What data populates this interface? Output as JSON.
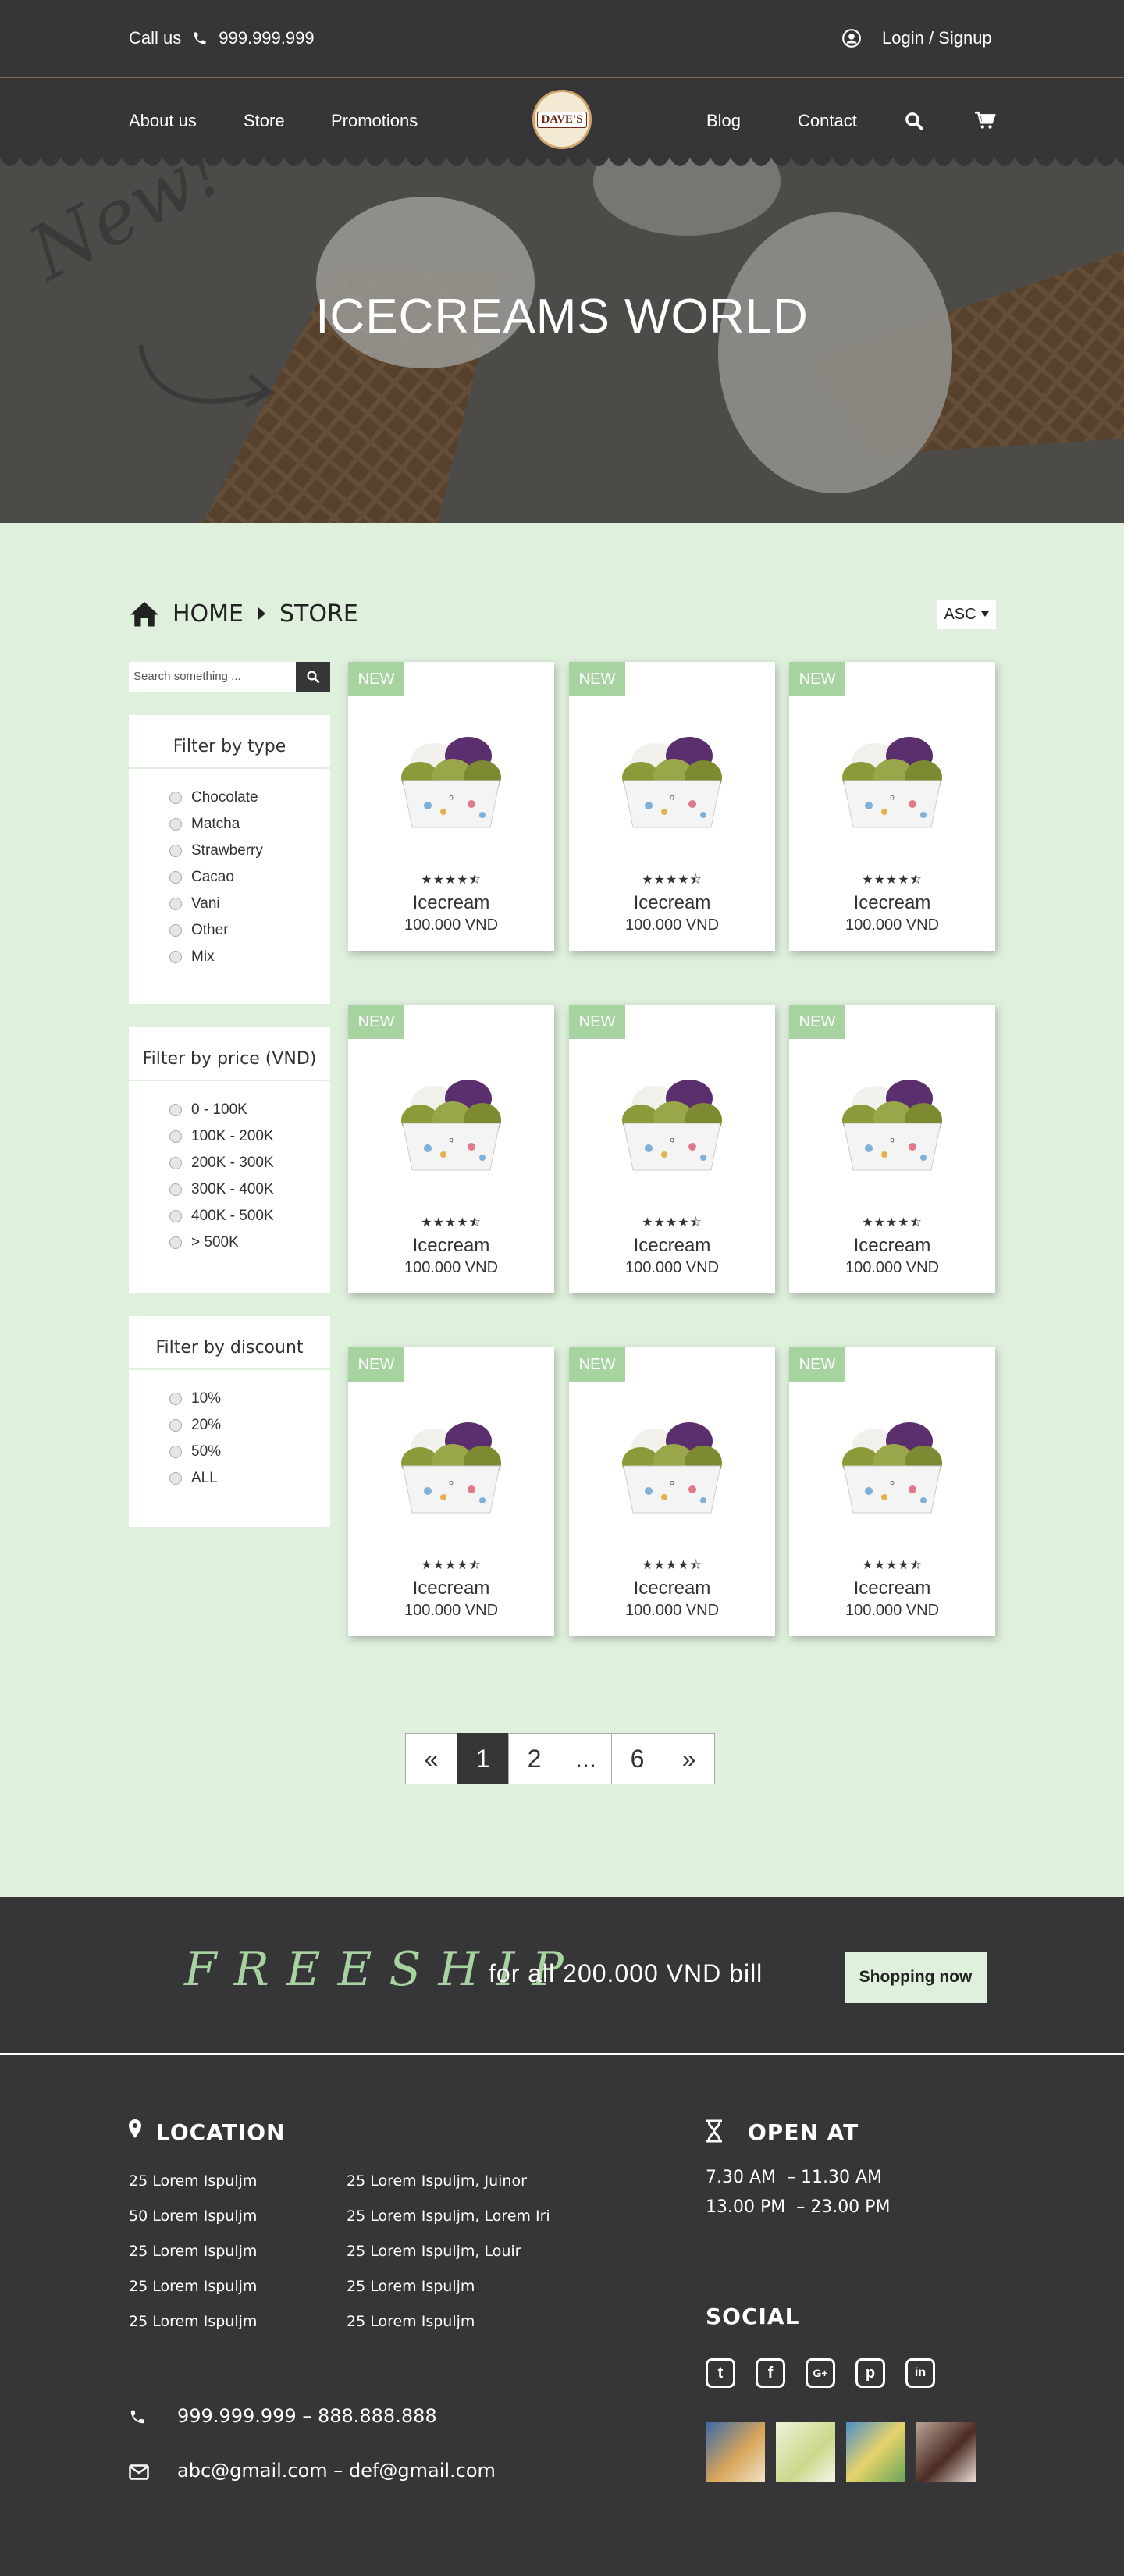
{
  "topbar": {
    "call_label": "Call us",
    "phone": "999.999.999",
    "login": "Login / Signup"
  },
  "nav": {
    "about": "About us",
    "store": "Store",
    "promotions": "Promotions",
    "blog": "Blog",
    "contact": "Contact",
    "logo_text": "DAVE'S"
  },
  "hero": {
    "title": "ICECREAMS WORLD",
    "badge": "New!"
  },
  "breadcrumb": {
    "home": "HOME",
    "store": "STORE"
  },
  "sort": {
    "value": "ASC"
  },
  "search": {
    "placeholder": "Search something ..."
  },
  "filters": [
    {
      "title": "Filter by type",
      "options": [
        "Chocolate",
        "Matcha",
        "Strawberry",
        "Cacao",
        "Vani",
        "Other",
        "Mix"
      ]
    },
    {
      "title": "Filter by price (VND)",
      "options": [
        "0 - 100K",
        "100K - 200K",
        "200K - 300K",
        "300K - 400K",
        "400K - 500K",
        "> 500K"
      ]
    },
    {
      "title": "Filter by discount",
      "options": [
        "10%",
        "20%",
        "50%",
        "ALL"
      ]
    }
  ],
  "products": [
    {
      "tag": "NEW",
      "name": "Icecream",
      "price": "100.000 VND",
      "rating": 4.5
    },
    {
      "tag": "NEW",
      "name": "Icecream",
      "price": "100.000 VND",
      "rating": 4.5
    },
    {
      "tag": "NEW",
      "name": "Icecream",
      "price": "100.000 VND",
      "rating": 4.5
    },
    {
      "tag": "NEW",
      "name": "Icecream",
      "price": "100.000 VND",
      "rating": 4.5
    },
    {
      "tag": "NEW",
      "name": "Icecream",
      "price": "100.000 VND",
      "rating": 4.5
    },
    {
      "tag": "NEW",
      "name": "Icecream",
      "price": "100.000 VND",
      "rating": 4.5
    },
    {
      "tag": "NEW",
      "name": "Icecream",
      "price": "100.000 VND",
      "rating": 4.5
    },
    {
      "tag": "NEW",
      "name": "Icecream",
      "price": "100.000 VND",
      "rating": 4.5
    },
    {
      "tag": "NEW",
      "name": "Icecream",
      "price": "100.000 VND",
      "rating": 4.5
    }
  ],
  "pagination": {
    "prev": "«",
    "pages": [
      "1",
      "2",
      "...",
      "6"
    ],
    "next": "»",
    "current": "1"
  },
  "promo": {
    "headline": "FREESHIP",
    "text": "for all 200.000 VND bill",
    "button": "Shopping now"
  },
  "footer": {
    "location_title": "LOCATION",
    "addresses_left": [
      "25 Lorem Ispuljm",
      "50 Lorem Ispuljm",
      "25 Lorem Ispuljm",
      "25 Lorem Ispuljm",
      "25 Lorem Ispuljm"
    ],
    "addresses_right": [
      "25 Lorem Ispuljm, Juinor",
      "25 Lorem Ispuljm, Lorem Iri",
      "25 Lorem Ispuljm, Louir",
      "25 Lorem Ispuljm",
      "25 Lorem Ispuljm"
    ],
    "open_title": "OPEN AT",
    "hours": [
      "7.30 AM  – 11.30 AM",
      "13.00 PM  – 23.00 PM"
    ],
    "social_title": "SOCIAL",
    "phone": "999.999.999 – 888.888.888",
    "email": "abc@gmail.com – def@gmail.com"
  },
  "colors": {
    "dark": "#363638",
    "mint": "#dff0dd",
    "accent": "#a6d3a0"
  }
}
